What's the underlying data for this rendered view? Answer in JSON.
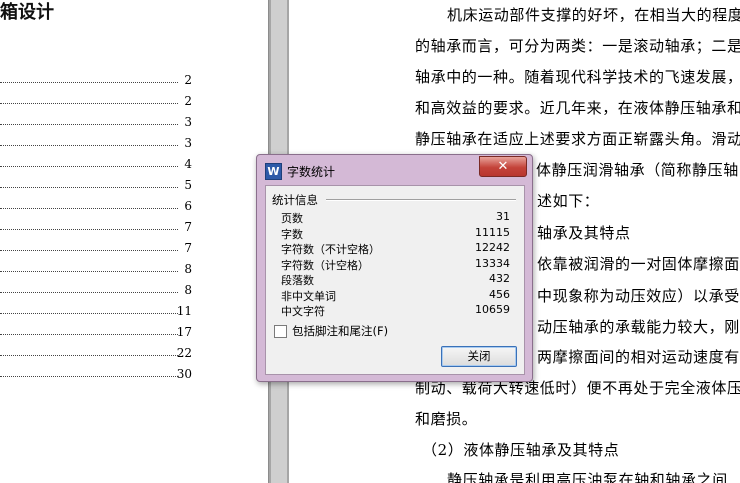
{
  "left_page": {
    "title_fragment": "箱设计",
    "toc_page_numbers": [
      "2",
      "2",
      "3",
      "3",
      "4",
      "5",
      "6",
      "7",
      "7",
      "8",
      "8",
      "11",
      "17",
      "22",
      "30"
    ]
  },
  "right_page": {
    "lines": [
      "机床运动部件支撑的好坏，在相当大的程度",
      "的轴承而言，可分为两类：一是滚动轴承；二是",
      "轴承中的一种。随着现代科学技术的飞速发展，",
      "和高效益的要求。近几年来，在液体静压轴承和",
      "静压轴承在适应上述要求方面正崭露头角。滑动",
      "体静压润滑轴承（简称静压轴",
      "述如下：",
      "轴承及其特点",
      "依靠被润滑的一对固体摩擦面",
      "中现象称为动压效应）以承受外",
      "动压轴承的承载能力较大，刚",
      "两摩擦面间的相对运动速度有关",
      "制动、载荷大转速低时）便不再处于完全液体压",
      "和磨损。",
      "（2）液体静压轴承及其特点",
      "静压轴承是利用高压油泵在轴和轴承之间"
    ]
  },
  "dialog": {
    "app_icon": "W",
    "title": "字数统计",
    "close_glyph": "✕",
    "group_label": "统计信息",
    "stats": [
      {
        "label": "页数",
        "value": "31"
      },
      {
        "label": "字数",
        "value": "11115"
      },
      {
        "label": "字符数（不计空格）",
        "value": "12242"
      },
      {
        "label": "字符数（计空格）",
        "value": "13334"
      },
      {
        "label": "段落数",
        "value": "432"
      },
      {
        "label": "非中文单词",
        "value": "456"
      },
      {
        "label": "中文字符",
        "value": "10659"
      }
    ],
    "checkbox_label": "包括脚注和尾注(F)",
    "checkbox_checked": false,
    "close_button": "关闭"
  },
  "colors": {
    "dialog_frame": "#d4b9d6",
    "close_x": "#c4433a",
    "gutter": "#a6a6a6"
  }
}
